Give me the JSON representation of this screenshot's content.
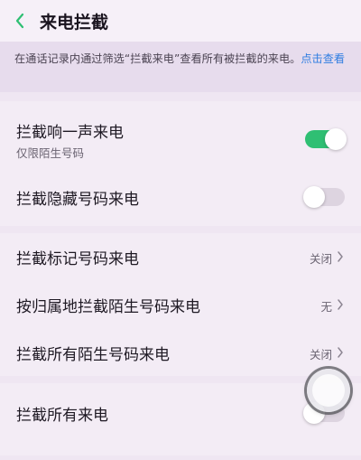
{
  "header": {
    "title": "来电拦截",
    "back_icon": "chevron-left-icon",
    "accent": "#2fbf73"
  },
  "notice": {
    "text": "在通话记录内通过筛选“拦截来电”查看所有被拦截的来电。",
    "link": "点击查看",
    "link_color": "#2f7de1"
  },
  "settings": {
    "ring_once": {
      "label": "拦截响一声来电",
      "sub": "仅限陌生号码",
      "toggle": "on"
    },
    "hidden_number": {
      "label": "拦截隐藏号码来电",
      "toggle": "off"
    },
    "marked_number": {
      "label": "拦截标记号码来电",
      "value": "关闭"
    },
    "location": {
      "label": "按归属地拦截陌生号码来电",
      "value": "无"
    },
    "all_strangers": {
      "label": "拦截所有陌生号码来电",
      "value": "关闭"
    },
    "all_calls": {
      "label": "拦截所有来电",
      "toggle": "off"
    }
  }
}
